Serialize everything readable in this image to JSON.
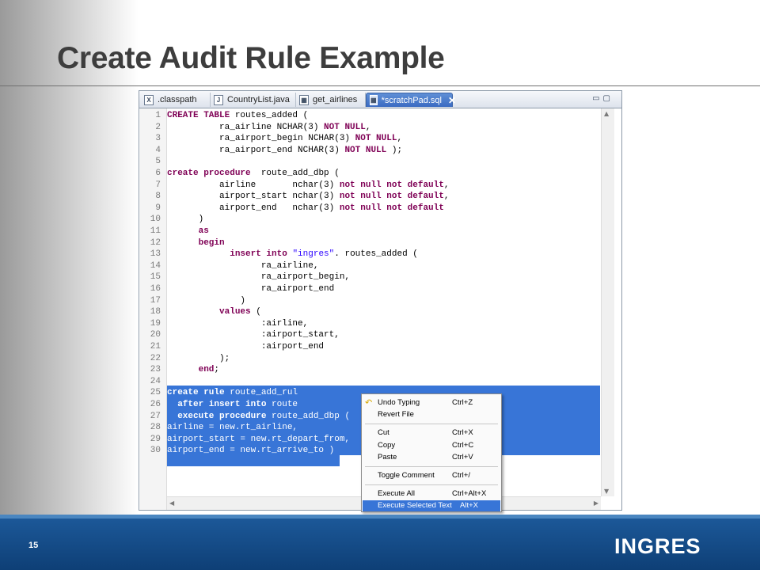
{
  "slide": {
    "title": "Create Audit Rule Example",
    "page_number": "15",
    "logo_text": "INGRES"
  },
  "editor": {
    "tabs": [
      {
        "label": ".classpath",
        "icon": "xml-file-icon",
        "active": false
      },
      {
        "label": "CountryList.java",
        "icon": "java-file-icon",
        "active": false
      },
      {
        "label": "get_airlines",
        "icon": "table-icon",
        "active": false
      },
      {
        "label": "*scratchPad.sql",
        "icon": "sql-file-icon",
        "active": true
      }
    ],
    "lines": [
      {
        "n": "1",
        "selected": false,
        "segs": [
          [
            "kw",
            "CREATE TABLE"
          ],
          [
            "t",
            " routes_added ("
          ]
        ]
      },
      {
        "n": "2",
        "selected": false,
        "segs": [
          [
            "t",
            "          ra_airline NCHAR(3) "
          ],
          [
            "kw",
            "NOT NULL"
          ],
          [
            "t",
            ","
          ]
        ]
      },
      {
        "n": "3",
        "selected": false,
        "segs": [
          [
            "t",
            "          ra_airport_begin NCHAR(3) "
          ],
          [
            "kw",
            "NOT NULL"
          ],
          [
            "t",
            ","
          ]
        ]
      },
      {
        "n": "4",
        "selected": false,
        "segs": [
          [
            "t",
            "          ra_airport_end NCHAR(3) "
          ],
          [
            "kw",
            "NOT NULL"
          ],
          [
            "t",
            " );"
          ]
        ]
      },
      {
        "n": "5",
        "selected": false,
        "segs": [
          [
            "t",
            ""
          ]
        ]
      },
      {
        "n": "6",
        "selected": false,
        "segs": [
          [
            "kw",
            "create procedure"
          ],
          [
            "t",
            "  route_add_dbp ("
          ]
        ]
      },
      {
        "n": "7",
        "selected": false,
        "segs": [
          [
            "t",
            "          airline       nchar(3) "
          ],
          [
            "kw",
            "not null not default"
          ],
          [
            "t",
            ","
          ]
        ]
      },
      {
        "n": "8",
        "selected": false,
        "segs": [
          [
            "t",
            "          airport_start nchar(3) "
          ],
          [
            "kw",
            "not null not default"
          ],
          [
            "t",
            ","
          ]
        ]
      },
      {
        "n": "9",
        "selected": false,
        "segs": [
          [
            "t",
            "          airport_end   nchar(3) "
          ],
          [
            "kw",
            "not null not default"
          ]
        ]
      },
      {
        "n": "10",
        "selected": false,
        "segs": [
          [
            "t",
            "      )"
          ]
        ]
      },
      {
        "n": "11",
        "selected": false,
        "segs": [
          [
            "t",
            "      "
          ],
          [
            "kw",
            "as"
          ]
        ]
      },
      {
        "n": "12",
        "selected": false,
        "segs": [
          [
            "t",
            "      "
          ],
          [
            "kw",
            "begin"
          ]
        ]
      },
      {
        "n": "13",
        "selected": false,
        "segs": [
          [
            "t",
            "            "
          ],
          [
            "kw",
            "insert into"
          ],
          [
            "t",
            " "
          ],
          [
            "str",
            "\"ingres\""
          ],
          [
            "t",
            ". routes_added ("
          ]
        ]
      },
      {
        "n": "14",
        "selected": false,
        "segs": [
          [
            "t",
            "                  ra_airline,"
          ]
        ]
      },
      {
        "n": "15",
        "selected": false,
        "segs": [
          [
            "t",
            "                  ra_airport_begin,"
          ]
        ]
      },
      {
        "n": "16",
        "selected": false,
        "segs": [
          [
            "t",
            "                  ra_airport_end"
          ]
        ]
      },
      {
        "n": "17",
        "selected": false,
        "segs": [
          [
            "t",
            "              )"
          ]
        ]
      },
      {
        "n": "18",
        "selected": false,
        "segs": [
          [
            "t",
            "          "
          ],
          [
            "kw",
            "values"
          ],
          [
            "t",
            " ("
          ]
        ]
      },
      {
        "n": "19",
        "selected": false,
        "segs": [
          [
            "t",
            "                  :airline,"
          ]
        ]
      },
      {
        "n": "20",
        "selected": false,
        "segs": [
          [
            "t",
            "                  :airport_start,"
          ]
        ]
      },
      {
        "n": "21",
        "selected": false,
        "segs": [
          [
            "t",
            "                  :airport_end"
          ]
        ]
      },
      {
        "n": "22",
        "selected": false,
        "segs": [
          [
            "t",
            "          );"
          ]
        ]
      },
      {
        "n": "23",
        "selected": false,
        "segs": [
          [
            "t",
            "      "
          ],
          [
            "kw",
            "end"
          ],
          [
            "t",
            ";"
          ]
        ]
      },
      {
        "n": "24",
        "selected": false,
        "segs": [
          [
            "t",
            ""
          ]
        ]
      },
      {
        "n": "25",
        "selected": true,
        "segs": [
          [
            "kw",
            "create rule"
          ],
          [
            "t",
            " route_add_rul"
          ]
        ]
      },
      {
        "n": "26",
        "selected": true,
        "segs": [
          [
            "t",
            "  "
          ],
          [
            "kw",
            "after insert into"
          ],
          [
            "t",
            " route"
          ]
        ]
      },
      {
        "n": "27",
        "selected": true,
        "segs": [
          [
            "t",
            "  "
          ],
          [
            "kw",
            "execute procedure"
          ],
          [
            "t",
            " route_add_dbp ("
          ]
        ]
      },
      {
        "n": "28",
        "selected": true,
        "segs": [
          [
            "t",
            "airline = new.rt_airline,"
          ]
        ]
      },
      {
        "n": "29",
        "selected": true,
        "segs": [
          [
            "t",
            "airport_start = new.rt_depart_from,"
          ]
        ]
      },
      {
        "n": "30",
        "selected": true,
        "segs": [
          [
            "t",
            "airport_end = new.rt_arrive_to )"
          ]
        ]
      }
    ]
  },
  "context_menu": {
    "items": [
      {
        "label": "Undo Typing",
        "shortcut": "Ctrl+Z",
        "icon": "undo-icon"
      },
      {
        "label": "Revert File",
        "shortcut": ""
      },
      {
        "label": "Cut",
        "shortcut": "Ctrl+X"
      },
      {
        "label": "Copy",
        "shortcut": "Ctrl+C"
      },
      {
        "label": "Paste",
        "shortcut": "Ctrl+V"
      },
      {
        "label": "Toggle Comment",
        "shortcut": "Ctrl+/"
      },
      {
        "label": "Execute All",
        "shortcut": "Ctrl+Alt+X"
      },
      {
        "label": "Execute Selected Text",
        "shortcut": "Alt+X",
        "highlighted": true
      }
    ]
  },
  "colors": {
    "keyword": "#7f0055",
    "string": "#2a00ff",
    "selection": "#3875d7",
    "footer": "#1d5a9b"
  }
}
